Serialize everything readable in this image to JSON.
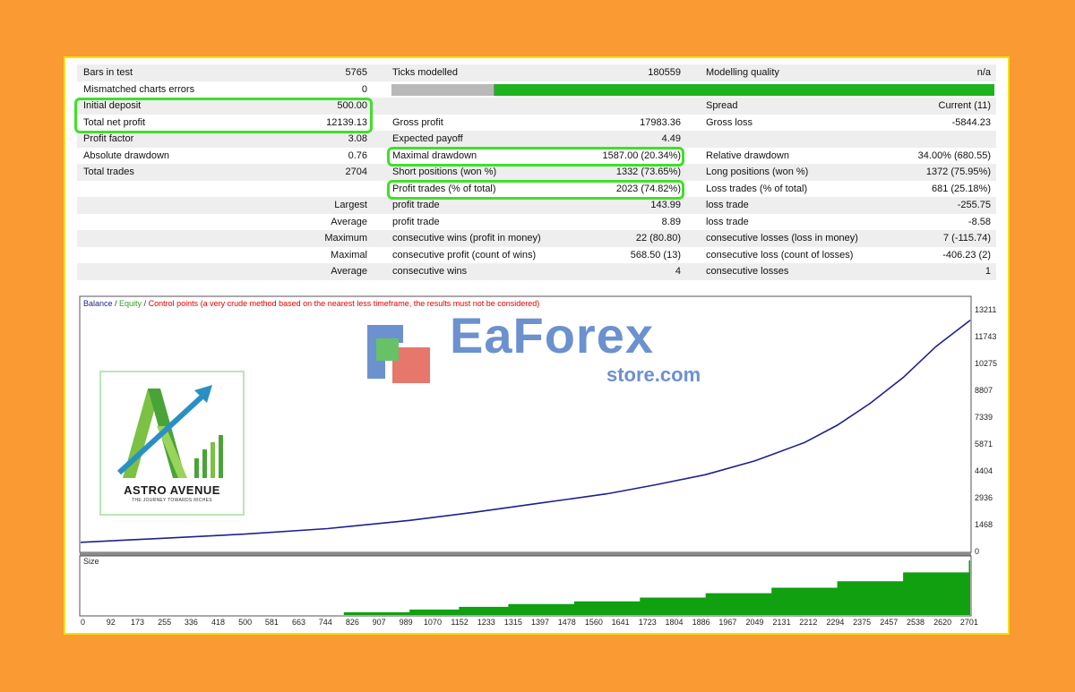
{
  "report": {
    "rows": [
      {
        "c1l": "Bars in test",
        "c1v": "5765",
        "c2l": "Ticks modelled",
        "c2v": "180559",
        "c3l": "Modelling quality",
        "c3v": "n/a"
      },
      {
        "c1l": "Mismatched charts errors",
        "c1v": "0",
        "c2l": "",
        "c2v": "",
        "c3l": "",
        "c3v": ""
      },
      {
        "c1l": "Initial deposit",
        "c1v": "500.00",
        "c2l": "",
        "c2v": "",
        "c3l": "Spread",
        "c3v": "Current (11)"
      },
      {
        "c1l": "Total net profit",
        "c1v": "12139.13",
        "c2l": "Gross profit",
        "c2v": "17983.36",
        "c3l": "Gross loss",
        "c3v": "-5844.23"
      },
      {
        "c1l": "Profit factor",
        "c1v": "3.08",
        "c2l": "Expected payoff",
        "c2v": "4.49",
        "c3l": "",
        "c3v": ""
      },
      {
        "c1l": "Absolute drawdown",
        "c1v": "0.76",
        "c2l": "Maximal drawdown",
        "c2v": "1587.00 (20.34%)",
        "c3l": "Relative drawdown",
        "c3v": "34.00% (680.55)"
      },
      {
        "c1l": "Total trades",
        "c1v": "2704",
        "c2l": "Short positions (won %)",
        "c2v": "1332 (73.65%)",
        "c3l": "Long positions (won %)",
        "c3v": "1372 (75.95%)"
      },
      {
        "c1l": "",
        "c1v": "",
        "c2l": "Profit trades (% of total)",
        "c2v": "2023 (74.82%)",
        "c3l": "Loss trades (% of total)",
        "c3v": "681 (25.18%)"
      },
      {
        "c1l": "",
        "c1v": "Largest",
        "c2l": "profit trade",
        "c2v": "143.99",
        "c3l": "loss trade",
        "c3v": "-255.75"
      },
      {
        "c1l": "",
        "c1v": "Average",
        "c2l": "profit trade",
        "c2v": "8.89",
        "c3l": "loss trade",
        "c3v": "-8.58"
      },
      {
        "c1l": "",
        "c1v": "Maximum",
        "c2l": "consecutive wins (profit in money)",
        "c2v": "22 (80.80)",
        "c3l": "consecutive losses (loss in money)",
        "c3v": "7 (-115.74)"
      },
      {
        "c1l": "",
        "c1v": "Maximal",
        "c2l": "consecutive profit (count of wins)",
        "c2v": "568.50 (13)",
        "c3l": "consecutive loss (count of losses)",
        "c3v": "-406.23 (2)"
      },
      {
        "c1l": "",
        "c1v": "Average",
        "c2l": "consecutive wins",
        "c2v": "4",
        "c3l": "consecutive losses",
        "c3v": "1"
      }
    ],
    "modelling_quality_fraction": 0.17
  },
  "chart_legend": {
    "balance": "Balance",
    "sep1": " / ",
    "equity": "Equity",
    "sep2": " / ",
    "control": "Control points (a very crude method based on the nearest less timeframe, the results must not be considered)"
  },
  "size_label": "Size",
  "watermark": {
    "main": "EaForex",
    "sub": "store.com"
  },
  "logo": {
    "brand": "ASTRO AVENUE",
    "tagline": "THE JOURNEY TOWARDS RICHES"
  },
  "colors": {
    "balance": "#1f1f8f",
    "equity": "#2aa12a",
    "control": "#e00000",
    "volume": "#10a010",
    "highlight": "#3fe028",
    "quality_bar": "#1fb21f"
  },
  "chart_data": {
    "type": "line",
    "xlabel": "",
    "ylabel": "",
    "ylim": [
      0,
      13211
    ],
    "y_ticks": [
      13211,
      11743,
      10275,
      8807,
      7339,
      5871,
      4404,
      2936,
      1468,
      0
    ],
    "x_ticks": [
      0,
      92,
      173,
      255,
      336,
      418,
      500,
      581,
      663,
      744,
      826,
      907,
      989,
      1070,
      1152,
      1233,
      1315,
      1397,
      1478,
      1560,
      1641,
      1723,
      1804,
      1886,
      1967,
      2049,
      2131,
      2212,
      2294,
      2375,
      2457,
      2538,
      2620,
      2701
    ],
    "xlim": [
      0,
      2704
    ],
    "series": [
      {
        "name": "Balance",
        "x": [
          0,
          250,
          500,
          750,
          1000,
          1200,
          1400,
          1600,
          1750,
          1900,
          2050,
          2200,
          2300,
          2400,
          2500,
          2600,
          2704
        ],
        "values": [
          500,
          720,
          950,
          1250,
          1700,
          2150,
          2650,
          3150,
          3650,
          4200,
          4950,
          5950,
          6900,
          8100,
          9500,
          11200,
          12639
        ]
      }
    ],
    "volume": {
      "x": [
        0,
        800,
        1000,
        1150,
        1300,
        1500,
        1700,
        1900,
        2100,
        2300,
        2500,
        2700
      ],
      "values": [
        0,
        0.05,
        0.1,
        0.15,
        0.2,
        0.25,
        0.32,
        0.4,
        0.5,
        0.62,
        0.78,
        1.0
      ]
    }
  }
}
